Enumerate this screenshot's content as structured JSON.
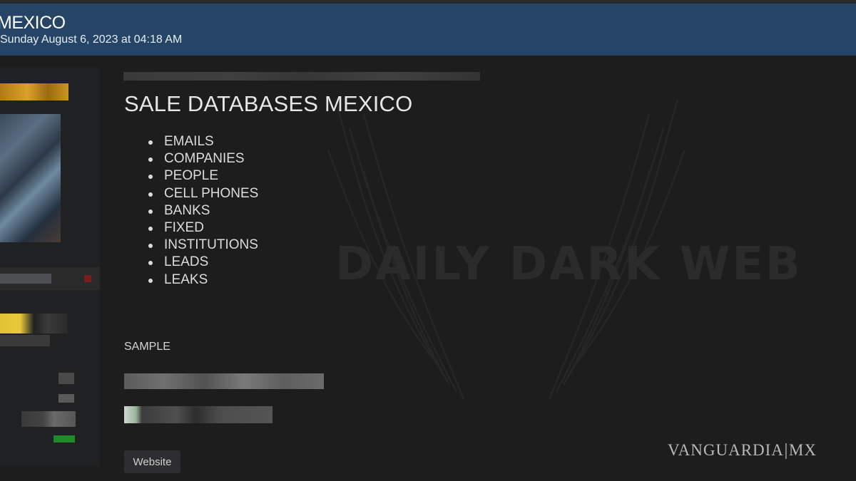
{
  "header": {
    "title": "MEXICO",
    "date": "Sunday August 6, 2023 at 04:18 AM"
  },
  "post": {
    "title": "SALE DATABASES MEXICO",
    "items": [
      "EMAILS",
      "COMPANIES",
      "PEOPLE",
      "CELL PHONES",
      "BANKS",
      "FIXED",
      "INSTITUTIONS",
      "LEADS",
      "LEAKS"
    ],
    "sample_label": "SAMPLE",
    "website_button": "Website"
  },
  "watermark": {
    "text": "DAILY DARK WEB",
    "icon": "wings-icon"
  },
  "brand": {
    "name": "VANGUARDIA",
    "separator": "|",
    "suffix": "MX"
  },
  "colors": {
    "header_bg": "#264566",
    "page_bg": "#1d1d1e",
    "text": "#dcdcdc"
  }
}
